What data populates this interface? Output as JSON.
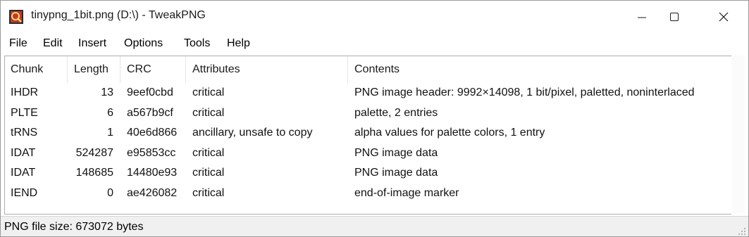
{
  "window": {
    "title": "tinypng_1bit.png (D:\\) - TweakPNG",
    "app_icon": "tweakpng-app-icon",
    "controls": [
      "minimize-icon",
      "maximize-icon",
      "close-icon"
    ]
  },
  "menu": {
    "items": [
      "File",
      "Edit",
      "Insert",
      "Options",
      "Tools",
      "Help"
    ]
  },
  "table": {
    "columns": [
      "Chunk",
      "Length",
      "CRC",
      "Attributes",
      "Contents"
    ],
    "rows": [
      {
        "chunk": "IHDR",
        "length": "13",
        "crc": "9eef0cbd",
        "attributes": "critical",
        "contents": "PNG image header: 9992×14098, 1 bit/pixel, paletted, noninterlaced"
      },
      {
        "chunk": "PLTE",
        "length": "6",
        "crc": "a567b9cf",
        "attributes": "critical",
        "contents": "palette, 2 entries"
      },
      {
        "chunk": "tRNS",
        "length": "1",
        "crc": "40e6d866",
        "attributes": "ancillary, unsafe to copy",
        "contents": "alpha values for palette colors, 1 entry"
      },
      {
        "chunk": "IDAT",
        "length": "524287",
        "crc": "e95853cc",
        "attributes": "critical",
        "contents": "PNG image data"
      },
      {
        "chunk": "IDAT",
        "length": "148685",
        "crc": "14480e93",
        "attributes": "critical",
        "contents": "PNG image data"
      },
      {
        "chunk": "IEND",
        "length": "0",
        "crc": "ae426082",
        "attributes": "critical",
        "contents": "end-of-image marker"
      }
    ]
  },
  "statusbar": {
    "text": "PNG file size: 673072 bytes"
  },
  "colors": {
    "border": "#adadad",
    "statusbar_bg": "#f0f0f0",
    "icon_red": "#c0392b"
  }
}
